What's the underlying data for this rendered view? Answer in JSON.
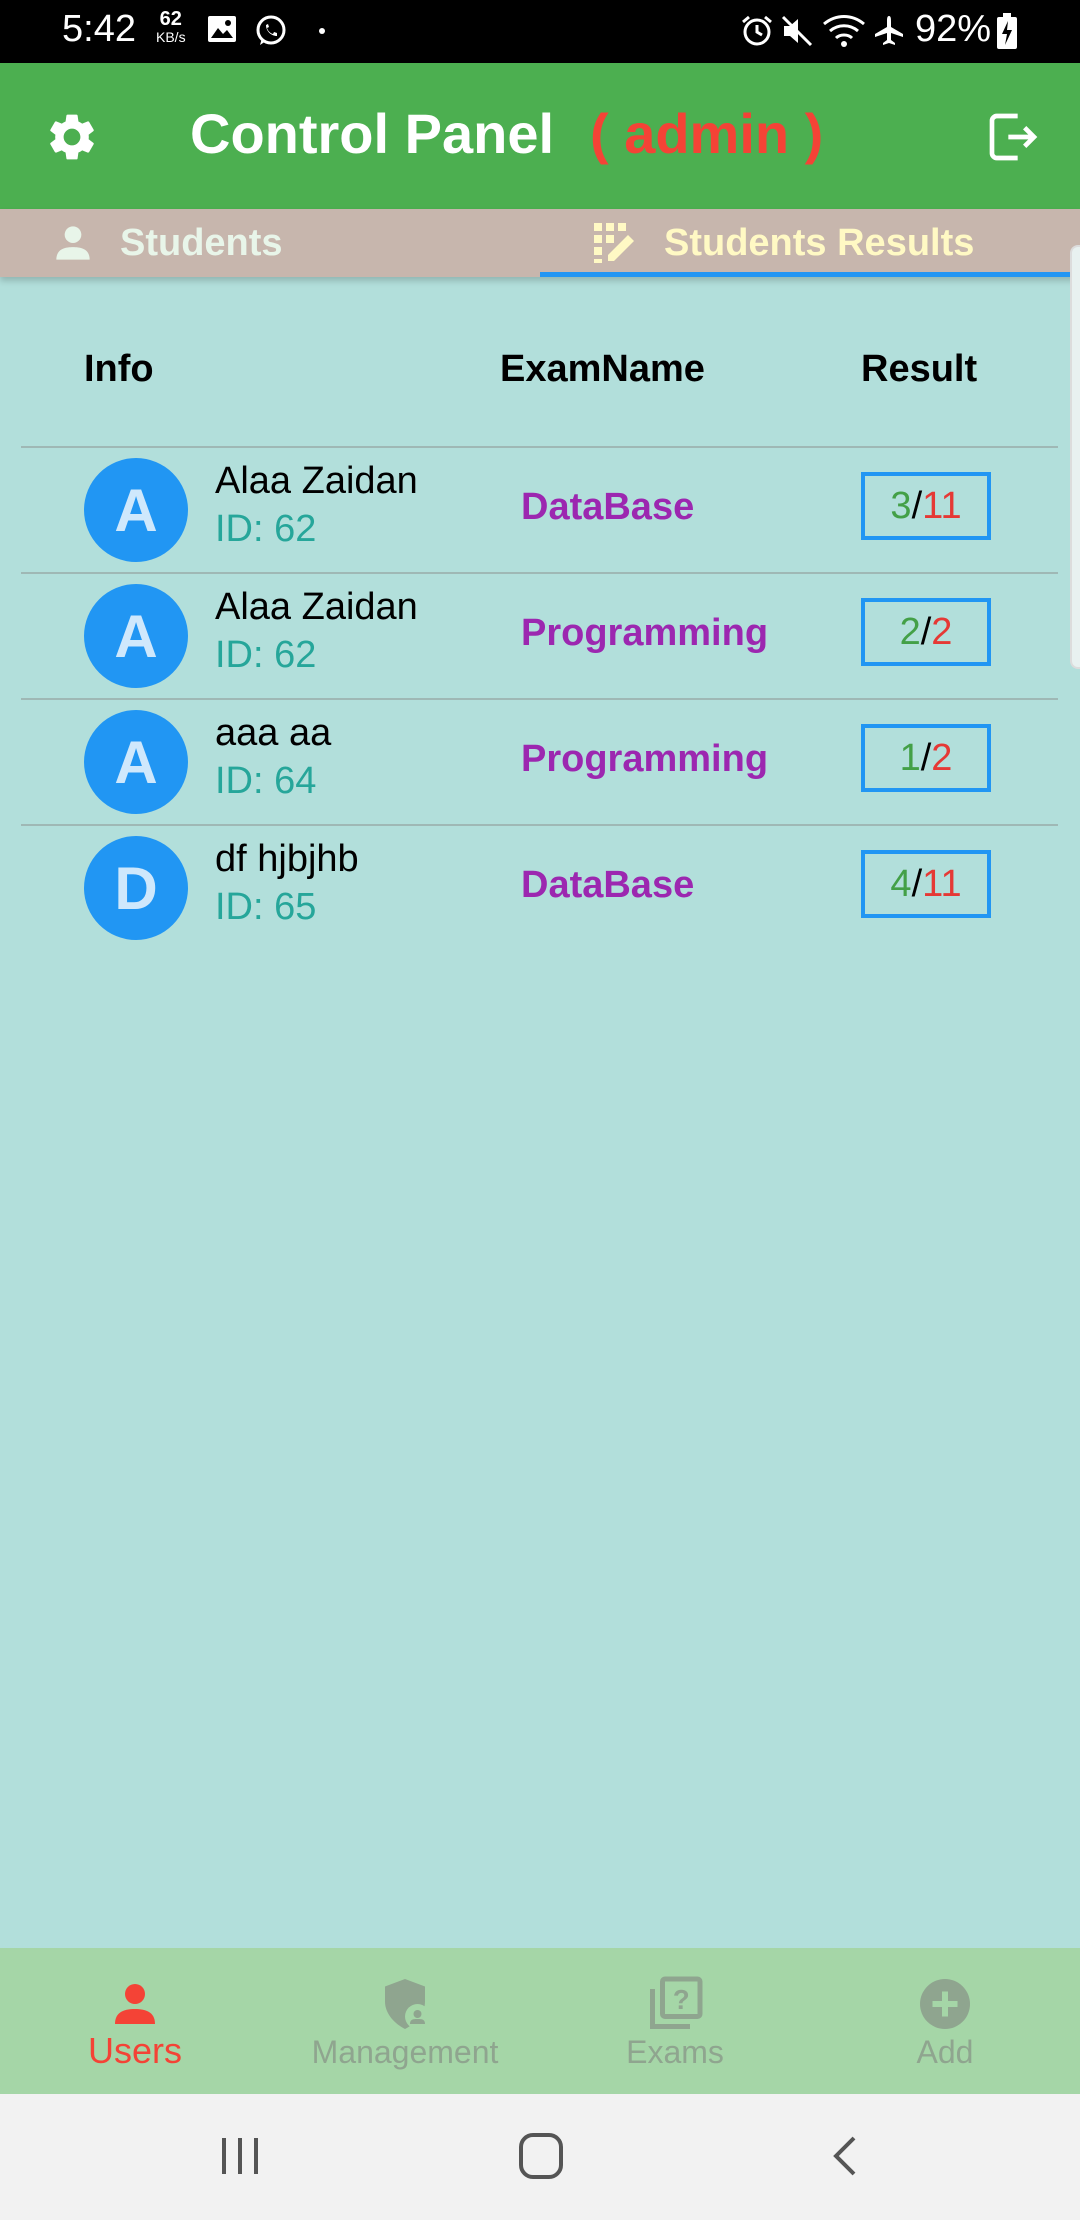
{
  "status_bar": {
    "time": "5:42",
    "net_speed": "62",
    "net_unit": "KB/s",
    "battery": "92%"
  },
  "app_bar": {
    "title": "Control Panel",
    "role": "( admin )"
  },
  "tabs": [
    {
      "label": "Students",
      "icon": "person-icon"
    },
    {
      "label": "Students Results",
      "icon": "edit-grid-icon",
      "selected": true
    }
  ],
  "table": {
    "headers": {
      "info": "Info",
      "exam": "ExamName",
      "result": "Result"
    },
    "rows": [
      {
        "initial": "A",
        "name": "Alaa Zaidan",
        "id": "ID: 62",
        "exam": "DataBase",
        "correct": "3",
        "sep": "/",
        "total": "11"
      },
      {
        "initial": "A",
        "name": "Alaa Zaidan",
        "id": "ID: 62",
        "exam": "Programming",
        "correct": "2",
        "sep": "/",
        "total": "2"
      },
      {
        "initial": "A",
        "name": "aaa aa",
        "id": "ID: 64",
        "exam": "Programming",
        "correct": "1",
        "sep": "/",
        "total": "2"
      },
      {
        "initial": "D",
        "name": "df hjbjhb",
        "id": "ID: 65",
        "exam": "DataBase",
        "correct": "4",
        "sep": "/",
        "total": "11"
      }
    ]
  },
  "bottom_nav": [
    {
      "label": "Users",
      "icon": "person-icon",
      "active": true
    },
    {
      "label": "Management",
      "icon": "admin-shield-icon"
    },
    {
      "label": "Exams",
      "icon": "quiz-icon"
    },
    {
      "label": "Add",
      "icon": "add-circle-icon"
    }
  ],
  "colors": {
    "app_bar": "#4caf50",
    "background": "#b2dfdb",
    "tab_bar": "#c7b6ad",
    "accent": "#2196f3",
    "role": "#f44336",
    "exam_name": "#9c27b0",
    "bottom_nav": "#a5d6a7"
  }
}
